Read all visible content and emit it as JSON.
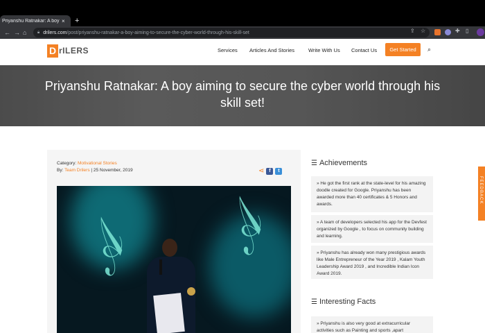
{
  "browser": {
    "tab_title": "Priyanshu Ratnakar: A boy aimi",
    "tab_close": "×",
    "new_tab": "+",
    "url_host": "drilers.com",
    "url_path": "/post/priyanshu-ratnakar-a-boy-aiming-to-secure-the-cyber-world-through-his-skill-set"
  },
  "site": {
    "logo_initial": "D",
    "logo_rest": "rILERS",
    "nav": [
      "Services",
      "Articles And Stories",
      "Write With Us",
      "Contact Us"
    ],
    "cta": "Get Started"
  },
  "hero": {
    "title": "Priyanshu Ratnakar: A boy aiming to secure the cyber world through his skill set!"
  },
  "article": {
    "category_label": "Category:",
    "category_value": "Motivational Stories",
    "by_label": "By:",
    "author": "Team Drilers",
    "date": "| 25 November, 2019"
  },
  "sidebar": {
    "achievements_title": "Achievements",
    "achievements": [
      "» He got the first rank at the state-level for his amazing doodle created for Google. Priyanshu has been awarded more than 40 certificates & 5 Honors and awards.",
      "» A team of developers selected his app for the Devfest organized by Google , to focus on community building and learning.",
      "» Priyanshu has already won many prestigious awards like Male Entrepreneur of the Year 2019 , Kalam Youth Leadership Award 2019 , and Incredible Indian Icon Award 2019."
    ],
    "facts_title": "Interesting Facts",
    "facts": [
      "» Priyanshu is also very good at extracurricular activities such as Painting and sports ,apart"
    ]
  },
  "feedback_label": "FEEDBACK",
  "colors": {
    "accent": "#f48124",
    "facebook": "#3b5998",
    "twitter": "#3a8fd8"
  }
}
